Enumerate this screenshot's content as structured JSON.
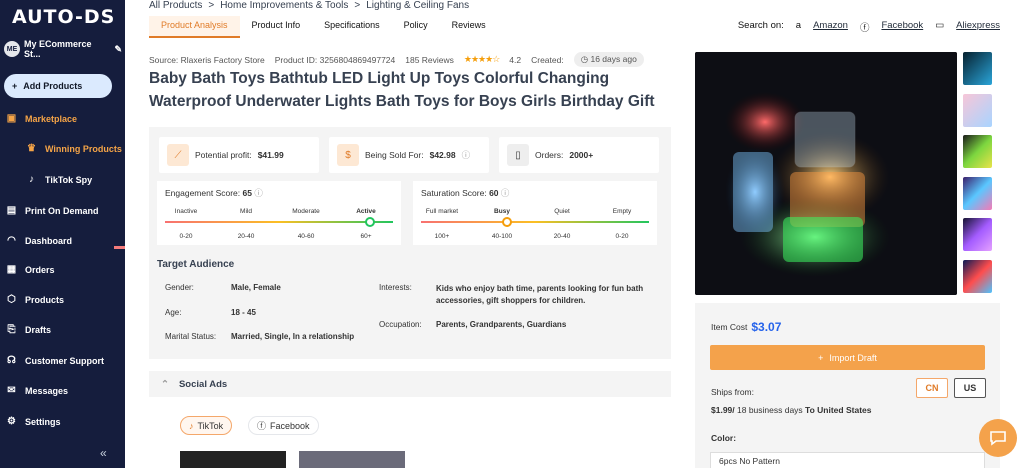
{
  "sidebar": {
    "logo": "AUTO-DS",
    "store_initials": "ME",
    "store_name": "My ECommerce St...",
    "add_products": "Add Products",
    "marketplace": "Marketplace",
    "winning_products": "Winning Products",
    "tiktok_spy": "TikTok Spy",
    "print_on_demand": "Print On Demand",
    "dashboard": "Dashboard",
    "orders": "Orders",
    "products": "Products",
    "drafts": "Drafts",
    "customer_support": "Customer Support",
    "messages": "Messages",
    "settings": "Settings",
    "collapse": "«"
  },
  "breadcrumbs": [
    "All Products",
    "Home Improvements & Tools",
    "Lighting & Ceiling Fans"
  ],
  "breadcrumb_sep": ">",
  "tabs": [
    "Product Analysis",
    "Product Info",
    "Specifications",
    "Policy",
    "Reviews"
  ],
  "search_on": {
    "label": "Search on:",
    "sites": [
      "Amazon",
      "Facebook",
      "Aliexpress"
    ]
  },
  "meta": {
    "source": "Source: Rlaxeris Factory Store",
    "product_id": "Product ID: 3256804869497724",
    "reviews": "185 Reviews",
    "rating": "4.2",
    "rating_stars": 4,
    "created_label": "Created:",
    "created_value": "16 days ago"
  },
  "title": "Baby Bath Toys Bathtub LED Light Up Toys Colorful Changing Waterproof Underwater Lights Bath Toys for Boys Girls Birthday Gift",
  "stats": {
    "profit_label": "Potential profit:",
    "profit_value": "$41.99",
    "sold_label": "Being Sold For:",
    "sold_value": "$42.98",
    "orders_label": "Orders:",
    "orders_value": "2000+"
  },
  "engagement": {
    "label": "Engagement Score:",
    "value": "65",
    "level": 0.9,
    "levels": [
      "Inactive",
      "Mild",
      "Moderate",
      "Active"
    ],
    "ranges": [
      "0-20",
      "20-40",
      "40-60",
      "60+"
    ]
  },
  "saturation": {
    "label": "Saturation Score:",
    "value": "60",
    "level": 0.375,
    "levels": [
      "Full market",
      "Busy",
      "Quiet",
      "Empty"
    ],
    "ranges": [
      "100+",
      "40-100",
      "20-40",
      "0-20"
    ]
  },
  "audience": {
    "title": "Target Audience",
    "gender_label": "Gender:",
    "gender": "Male, Female",
    "age_label": "Age:",
    "age": "18 - 45",
    "marital_label": "Marital Status:",
    "marital": "Married, Single, In a relationship",
    "interests_label": "Interests:",
    "interests": "Kids who enjoy bath time, parents looking for fun bath accessories, gift shoppers for children.",
    "occupation_label": "Occupation:",
    "occupation": "Parents, Grandparents, Guardians"
  },
  "social": {
    "title": "Social Ads",
    "tiktok": "TikTok",
    "facebook": "Facebook"
  },
  "purchase": {
    "item_cost_label": "Item Cost",
    "item_cost": "$3.07",
    "import_label": "Import Draft",
    "ships_from_label": "Ships from:",
    "countries": [
      "CN",
      "US"
    ],
    "shipping_price": "$1.99/",
    "shipping_days": " 18 business days",
    "shipping_to": " To United States",
    "color_label": "Color:",
    "color_value": "6pcs No Pattern"
  },
  "colors": {
    "sidebar": "#151d3d",
    "accent": "#f4a24b",
    "link": "#2563eb"
  }
}
